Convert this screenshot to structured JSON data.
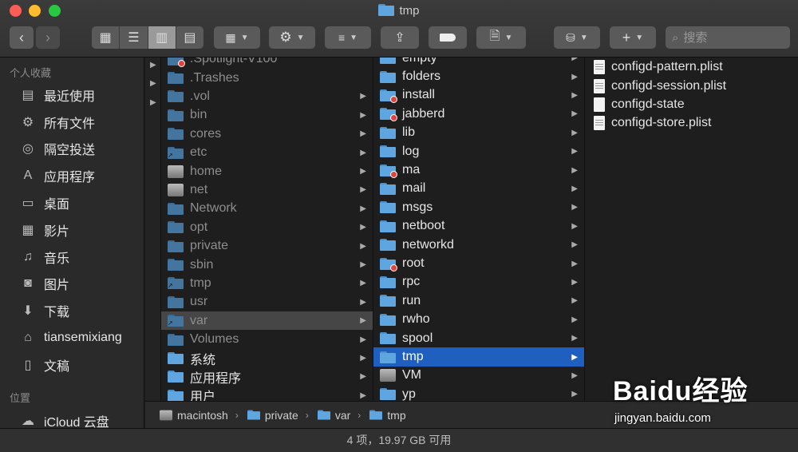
{
  "window": {
    "title": "tmp"
  },
  "toolbar": {
    "search_placeholder": "搜索"
  },
  "sidebar": {
    "favorites_heading": "个人收藏",
    "items": [
      {
        "label": "最近使用",
        "icon": "recents-icon"
      },
      {
        "label": "所有文件",
        "icon": "gear-icon"
      },
      {
        "label": "隔空投送",
        "icon": "airdrop-icon"
      },
      {
        "label": "应用程序",
        "icon": "applications-icon"
      },
      {
        "label": "桌面",
        "icon": "desktop-icon"
      },
      {
        "label": "影片",
        "icon": "movies-icon"
      },
      {
        "label": "音乐",
        "icon": "music-icon"
      },
      {
        "label": "图片",
        "icon": "camera-icon"
      },
      {
        "label": "下载",
        "icon": "download-icon"
      },
      {
        "label": "tiansemixiang",
        "icon": "home-icon"
      },
      {
        "label": "文稿",
        "icon": "documents-icon"
      }
    ],
    "locations_heading": "位置",
    "locations": [
      {
        "label": "iCloud 云盘",
        "icon": "cloud-icon"
      }
    ]
  },
  "column2": [
    {
      "name": ".Spotlight-V100",
      "dim": true,
      "badge": true,
      "arrow": false
    },
    {
      "name": ".Trashes",
      "dim": true,
      "badge": false,
      "arrow": false
    },
    {
      "name": ".vol",
      "dim": true,
      "arrow": true
    },
    {
      "name": "bin",
      "dim": true,
      "arrow": true
    },
    {
      "name": "cores",
      "dim": true,
      "arrow": true
    },
    {
      "name": "etc",
      "dim": true,
      "link": true,
      "arrow": true
    },
    {
      "name": "home",
      "dim": true,
      "drive": true,
      "arrow": true
    },
    {
      "name": "net",
      "dim": true,
      "drive": true,
      "arrow": true
    },
    {
      "name": "Network",
      "dim": true,
      "arrow": true
    },
    {
      "name": "opt",
      "dim": true,
      "arrow": true
    },
    {
      "name": "private",
      "dim": true,
      "arrow": true
    },
    {
      "name": "sbin",
      "dim": true,
      "arrow": true
    },
    {
      "name": "tmp",
      "dim": true,
      "link": true,
      "arrow": true
    },
    {
      "name": "usr",
      "dim": true,
      "arrow": true
    },
    {
      "name": "var",
      "dim": true,
      "link": true,
      "arrow": true,
      "selected": true
    },
    {
      "name": "Volumes",
      "dim": true,
      "arrow": true
    },
    {
      "name": "系统",
      "dim": false,
      "arrow": true
    },
    {
      "name": "应用程序",
      "dim": false,
      "arrow": true
    },
    {
      "name": "用户",
      "dim": false,
      "arrow": true
    }
  ],
  "column3": [
    {
      "name": "empty",
      "arrow": true
    },
    {
      "name": "folders",
      "arrow": true
    },
    {
      "name": "install",
      "badge": true,
      "arrow": true
    },
    {
      "name": "jabberd",
      "badge": true,
      "arrow": true
    },
    {
      "name": "lib",
      "arrow": true
    },
    {
      "name": "log",
      "arrow": true
    },
    {
      "name": "ma",
      "badge": true,
      "arrow": true
    },
    {
      "name": "mail",
      "arrow": true
    },
    {
      "name": "msgs",
      "arrow": true
    },
    {
      "name": "netboot",
      "arrow": true
    },
    {
      "name": "networkd",
      "arrow": true
    },
    {
      "name": "root",
      "badge": true,
      "arrow": true
    },
    {
      "name": "rpc",
      "arrow": true
    },
    {
      "name": "run",
      "arrow": true
    },
    {
      "name": "rwho",
      "arrow": true
    },
    {
      "name": "spool",
      "arrow": true
    },
    {
      "name": "tmp",
      "arrow": true,
      "selected": true
    },
    {
      "name": "VM",
      "drive": true,
      "arrow": true
    },
    {
      "name": "yp",
      "arrow": true
    }
  ],
  "column4": [
    {
      "name": "configd-pattern.plist",
      "lines": true
    },
    {
      "name": "configd-session.plist",
      "lines": true
    },
    {
      "name": "configd-state",
      "lines": false
    },
    {
      "name": "configd-store.plist",
      "lines": true
    }
  ],
  "pathbar": [
    {
      "label": "macintosh",
      "type": "drive"
    },
    {
      "label": "private",
      "type": "folder"
    },
    {
      "label": "var",
      "type": "folder"
    },
    {
      "label": "tmp",
      "type": "folder"
    }
  ],
  "status": {
    "text": "4 项，19.97 GB 可用"
  },
  "watermark": {
    "logo": "Baidu经验",
    "url": "jingyan.baidu.com"
  }
}
